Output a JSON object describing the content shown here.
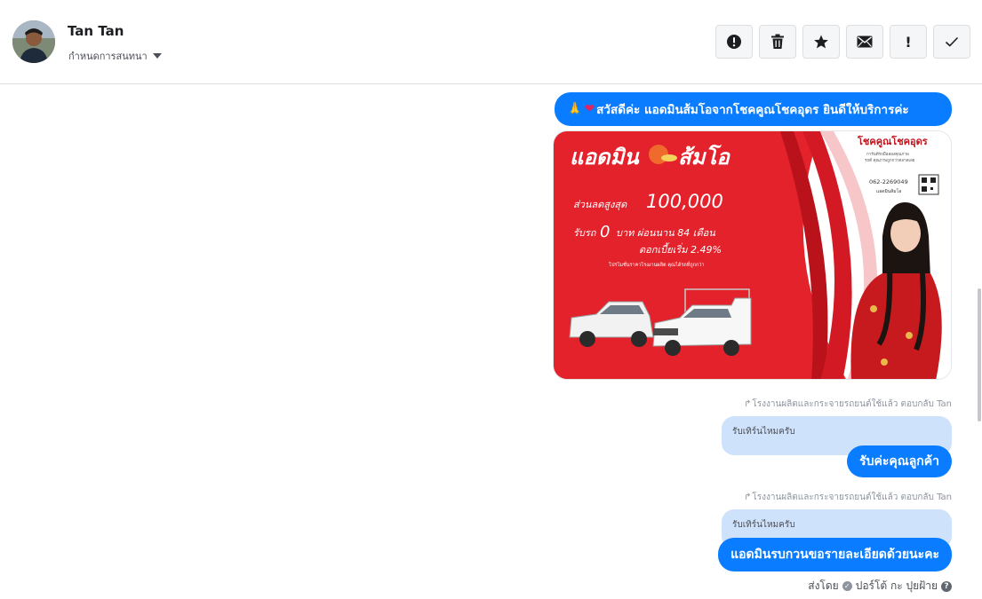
{
  "header": {
    "contact_name": "Tan Tan",
    "assign_label": "กำหนดการสนทนา"
  },
  "toolbar": {
    "buttons": [
      {
        "name": "alert-circle",
        "icon": "alert-circle-icon"
      },
      {
        "name": "delete",
        "icon": "trash-icon"
      },
      {
        "name": "star",
        "icon": "star-icon"
      },
      {
        "name": "mark-unread",
        "icon": "envelope-icon"
      },
      {
        "name": "important",
        "icon": "exclamation-icon",
        "glyph": "!"
      },
      {
        "name": "done",
        "icon": "checkmark-icon"
      }
    ]
  },
  "messages": {
    "greeting": "สวัสดีค่ะ แอดมินส้มโอจากโชคคูณโชคอุดร ยินดีให้บริการค่ะ",
    "promo": {
      "headline": "แอดมิน",
      "headline2": "ส้มโอ",
      "discount_label": "ส่วนลดสูงสุด",
      "discount_value": "100,000",
      "line1a": "รับรถ",
      "line1b": "0",
      "line1c": "บาท ผ่อนนาน 84 เดือน",
      "line2": "ดอกเบี้ยเริ่ม 2.49%",
      "fine_print": "โปรโมชั่นราคาโรงงานผลิต คุณได้รถที่ถูกกว่า",
      "brand": "โชคคูณโชคอุดร",
      "brand_sub": "การันตีรถมือสองคุณภาพ",
      "brand_sub2": "รถดี คุณภาพถูกกว่าตลาดเลย",
      "phone": "062-2269049",
      "admin_tag": "แอดมินส้มโอ"
    },
    "reply1": {
      "meta": "โรงงานผลิตและกระจายรถยนต์ใช้แล้ว ตอบกลับ Tan",
      "quoted": "รับเทิร์นไหมครับ",
      "text": "รับค่ะคุณลูกค้า"
    },
    "reply2": {
      "meta": "โรงงานผลิตและกระจายรถยนต์ใช้แล้ว ตอบกลับ Tan",
      "quoted": "รับเทิร์นไหมครับ",
      "text": "แอดมินรบกวนขอรายละเอียดด้วยนะคะ"
    },
    "sent_by": {
      "prefix": "ส่งโดย",
      "name": "ปอร์โต้ กะ ปุยฝ้าย"
    }
  },
  "colors": {
    "accent": "#0a7cff",
    "quoted_bg": "#cfe2fb",
    "promo_red": "#e3222c"
  }
}
